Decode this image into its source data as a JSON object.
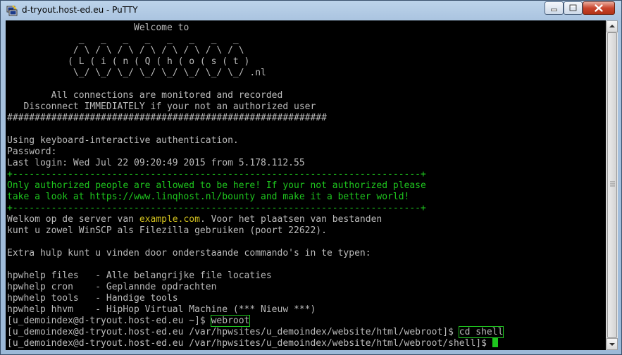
{
  "window": {
    "title": "d-tryout.host-ed.eu - PuTTY",
    "app_icon": "putty-icon"
  },
  "controls": {
    "minimize": "minimize-icon",
    "maximize": "maximize-icon",
    "close": "close-icon"
  },
  "colors": {
    "terminal_bg": "#000000",
    "terminal_fg": "#bbbbbb",
    "green": "#1ec61e",
    "yellow": "#d3c21e"
  },
  "terminal": {
    "welcome": "                       Welcome to",
    "logo1": "             _   _   _   _   _   _   _   _",
    "logo2": "            / \\ / \\ / \\ / \\ / \\ / \\ / \\ / \\",
    "logo3": "           ( L ( i ( n ( Q ( h ( o ( s ( t )",
    "logo4": "            \\_/ \\_/ \\_/ \\_/ \\_/ \\_/ \\_/ \\_/ .nl",
    "monitored": "        All connections are monitored and recorded",
    "disconnect": "   Disconnect IMMEDIATELY if your not an authorized user",
    "hashes": "##########################################################",
    "auth": "Using keyboard-interactive authentication.",
    "password": "Password:",
    "last_login": "Last login: Wed Jul 22 09:20:49 2015 from 5.178.112.55",
    "border1": "+--------------------------------------------------------------------------+",
    "warn1": "Only authorized people are allowed to be here! If your not authorized please",
    "warn2": "take a look at https://www.linqhost.nl/bounty and make it a better world!",
    "border2": "+--------------------------------------------------------------------------+",
    "welkom_pre": "Welkom op de server van ",
    "welkom_domain": "example.com",
    "welkom_post": ". Voor het plaatsen van bestanden",
    "welkom2": "kunt u zowel WinSCP als Filezilla gebruiken (poort 22622).",
    "extra": "Extra hulp kunt u vinden door onderstaande commando's in te typen:",
    "help_files": "hpwhelp files   - Alle belangrijke file locaties",
    "help_cron": "hpwhelp cron    - Geplannde opdrachten",
    "help_tools": "hpwhelp tools   - Handige tools",
    "help_hhvm": "hpwhelp hhvm    - HipHop Virtual Machine (*** Nieuw ***)",
    "prompt1": "[u_demoindex@d-tryout.host-ed.eu ~]$ ",
    "cmd1": "webroot",
    "prompt2": "[u_demoindex@d-tryout.host-ed.eu /var/hpwsites/u_demoindex/website/html/webroot]$ ",
    "cmd2": "cd shell",
    "prompt3": "[u_demoindex@d-tryout.host-ed.eu /var/hpwsites/u_demoindex/website/html/webroot/shell]$ "
  },
  "scrollbar": {
    "up": "arrow-up-icon",
    "down": "arrow-down-icon"
  }
}
